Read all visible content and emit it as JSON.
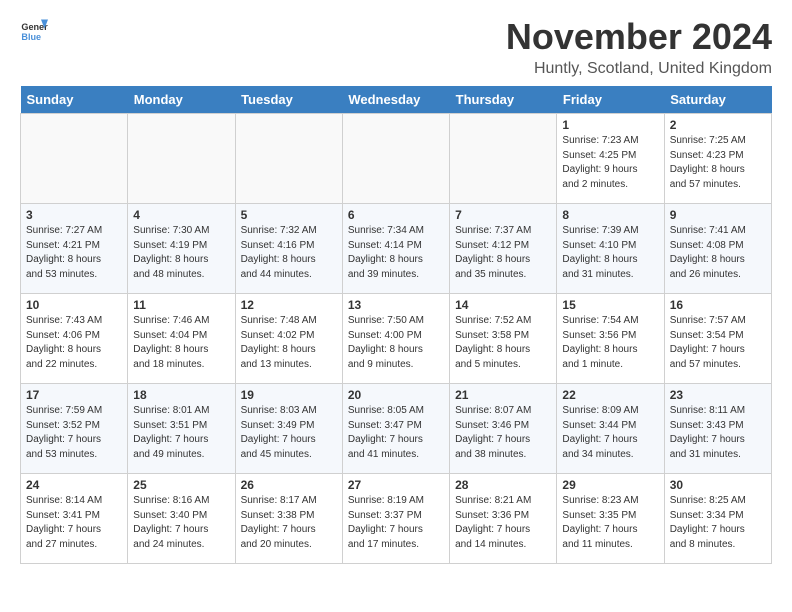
{
  "header": {
    "logo_general": "General",
    "logo_blue": "Blue",
    "title": "November 2024",
    "location": "Huntly, Scotland, United Kingdom"
  },
  "days_of_week": [
    "Sunday",
    "Monday",
    "Tuesday",
    "Wednesday",
    "Thursday",
    "Friday",
    "Saturday"
  ],
  "weeks": [
    [
      {
        "day": "",
        "info": ""
      },
      {
        "day": "",
        "info": ""
      },
      {
        "day": "",
        "info": ""
      },
      {
        "day": "",
        "info": ""
      },
      {
        "day": "",
        "info": ""
      },
      {
        "day": "1",
        "info": "Sunrise: 7:23 AM\nSunset: 4:25 PM\nDaylight: 9 hours\nand 2 minutes."
      },
      {
        "day": "2",
        "info": "Sunrise: 7:25 AM\nSunset: 4:23 PM\nDaylight: 8 hours\nand 57 minutes."
      }
    ],
    [
      {
        "day": "3",
        "info": "Sunrise: 7:27 AM\nSunset: 4:21 PM\nDaylight: 8 hours\nand 53 minutes."
      },
      {
        "day": "4",
        "info": "Sunrise: 7:30 AM\nSunset: 4:19 PM\nDaylight: 8 hours\nand 48 minutes."
      },
      {
        "day": "5",
        "info": "Sunrise: 7:32 AM\nSunset: 4:16 PM\nDaylight: 8 hours\nand 44 minutes."
      },
      {
        "day": "6",
        "info": "Sunrise: 7:34 AM\nSunset: 4:14 PM\nDaylight: 8 hours\nand 39 minutes."
      },
      {
        "day": "7",
        "info": "Sunrise: 7:37 AM\nSunset: 4:12 PM\nDaylight: 8 hours\nand 35 minutes."
      },
      {
        "day": "8",
        "info": "Sunrise: 7:39 AM\nSunset: 4:10 PM\nDaylight: 8 hours\nand 31 minutes."
      },
      {
        "day": "9",
        "info": "Sunrise: 7:41 AM\nSunset: 4:08 PM\nDaylight: 8 hours\nand 26 minutes."
      }
    ],
    [
      {
        "day": "10",
        "info": "Sunrise: 7:43 AM\nSunset: 4:06 PM\nDaylight: 8 hours\nand 22 minutes."
      },
      {
        "day": "11",
        "info": "Sunrise: 7:46 AM\nSunset: 4:04 PM\nDaylight: 8 hours\nand 18 minutes."
      },
      {
        "day": "12",
        "info": "Sunrise: 7:48 AM\nSunset: 4:02 PM\nDaylight: 8 hours\nand 13 minutes."
      },
      {
        "day": "13",
        "info": "Sunrise: 7:50 AM\nSunset: 4:00 PM\nDaylight: 8 hours\nand 9 minutes."
      },
      {
        "day": "14",
        "info": "Sunrise: 7:52 AM\nSunset: 3:58 PM\nDaylight: 8 hours\nand 5 minutes."
      },
      {
        "day": "15",
        "info": "Sunrise: 7:54 AM\nSunset: 3:56 PM\nDaylight: 8 hours\nand 1 minute."
      },
      {
        "day": "16",
        "info": "Sunrise: 7:57 AM\nSunset: 3:54 PM\nDaylight: 7 hours\nand 57 minutes."
      }
    ],
    [
      {
        "day": "17",
        "info": "Sunrise: 7:59 AM\nSunset: 3:52 PM\nDaylight: 7 hours\nand 53 minutes."
      },
      {
        "day": "18",
        "info": "Sunrise: 8:01 AM\nSunset: 3:51 PM\nDaylight: 7 hours\nand 49 minutes."
      },
      {
        "day": "19",
        "info": "Sunrise: 8:03 AM\nSunset: 3:49 PM\nDaylight: 7 hours\nand 45 minutes."
      },
      {
        "day": "20",
        "info": "Sunrise: 8:05 AM\nSunset: 3:47 PM\nDaylight: 7 hours\nand 41 minutes."
      },
      {
        "day": "21",
        "info": "Sunrise: 8:07 AM\nSunset: 3:46 PM\nDaylight: 7 hours\nand 38 minutes."
      },
      {
        "day": "22",
        "info": "Sunrise: 8:09 AM\nSunset: 3:44 PM\nDaylight: 7 hours\nand 34 minutes."
      },
      {
        "day": "23",
        "info": "Sunrise: 8:11 AM\nSunset: 3:43 PM\nDaylight: 7 hours\nand 31 minutes."
      }
    ],
    [
      {
        "day": "24",
        "info": "Sunrise: 8:14 AM\nSunset: 3:41 PM\nDaylight: 7 hours\nand 27 minutes."
      },
      {
        "day": "25",
        "info": "Sunrise: 8:16 AM\nSunset: 3:40 PM\nDaylight: 7 hours\nand 24 minutes."
      },
      {
        "day": "26",
        "info": "Sunrise: 8:17 AM\nSunset: 3:38 PM\nDaylight: 7 hours\nand 20 minutes."
      },
      {
        "day": "27",
        "info": "Sunrise: 8:19 AM\nSunset: 3:37 PM\nDaylight: 7 hours\nand 17 minutes."
      },
      {
        "day": "28",
        "info": "Sunrise: 8:21 AM\nSunset: 3:36 PM\nDaylight: 7 hours\nand 14 minutes."
      },
      {
        "day": "29",
        "info": "Sunrise: 8:23 AM\nSunset: 3:35 PM\nDaylight: 7 hours\nand 11 minutes."
      },
      {
        "day": "30",
        "info": "Sunrise: 8:25 AM\nSunset: 3:34 PM\nDaylight: 7 hours\nand 8 minutes."
      }
    ]
  ]
}
